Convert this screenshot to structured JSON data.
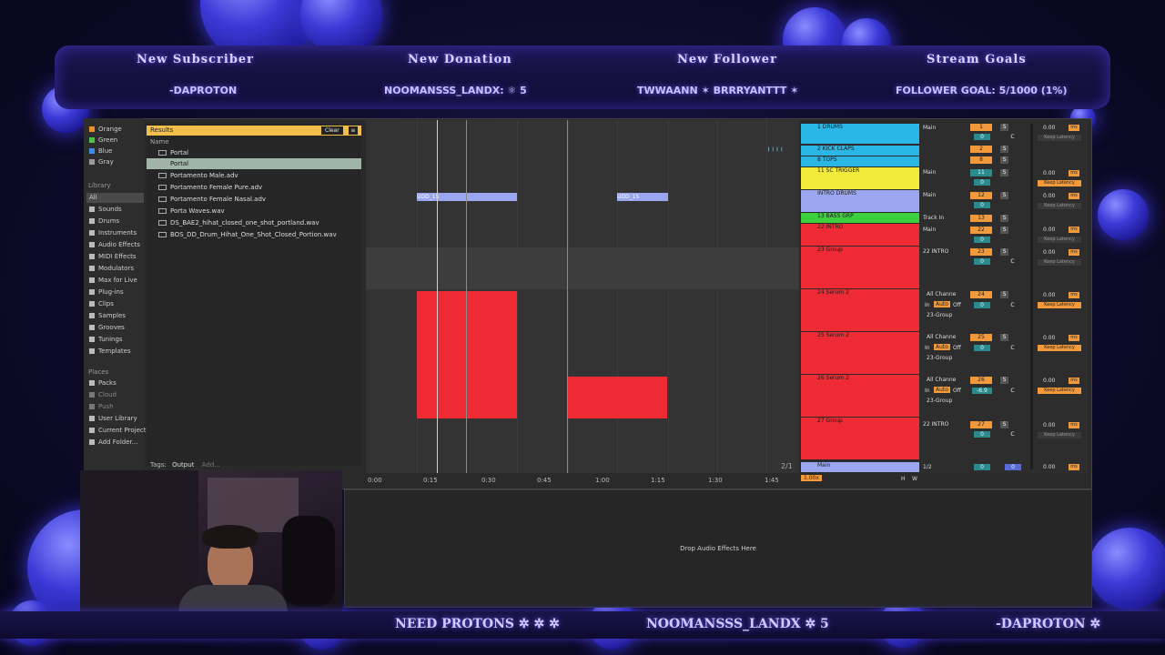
{
  "overlay": {
    "titles": [
      "New Subscriber",
      "New Donation",
      "New Follower",
      "Stream Goals"
    ],
    "subscriber": "-DAPROTON",
    "donation": "NOOMANSSS_LANDX: ⚛ 5",
    "followers": "TWWAANN  ✶  BRRRYANTTT  ✶",
    "goal": "FOLLOWER GOAL: 5/1000 (1%)",
    "bottom": [
      "NEED PROTONS ✲ ✲ ✲",
      "NOOMANSSS_LANDX ✲ 5",
      "-DAPROTON ✲"
    ]
  },
  "sidebar": {
    "colors": [
      {
        "label": "Orange",
        "color": "#f0902a"
      },
      {
        "label": "Green",
        "color": "#4cc24c"
      },
      {
        "label": "Blue",
        "color": "#3a8ee8"
      },
      {
        "label": "Gray",
        "color": "#9a9a9a"
      }
    ],
    "library_title": "Library",
    "library": [
      "All",
      "Sounds",
      "Drums",
      "Instruments",
      "Audio Effects",
      "MIDI Effects",
      "Modulators",
      "Max for Live",
      "Plug-ins",
      "Clips",
      "Samples",
      "Grooves",
      "Tunings",
      "Templates"
    ],
    "places_title": "Places",
    "places": [
      "Packs",
      "Cloud",
      "Push",
      "User Library",
      "Current Project",
      "Add Folder..."
    ]
  },
  "browser": {
    "results": "Results",
    "clear": "Clear",
    "name_header": "Name",
    "items": [
      "Portal",
      "Portal",
      "Portamento Male.adv",
      "Portamento Female Pure.adv",
      "Portamento Female Nasal.adv",
      "Porta Waves.wav",
      "DS_BAE2_hihat_closed_one_shot_portland.wav",
      "BOS_DD_Drum_Hihat_One_Shot_Closed_Portion.wav"
    ],
    "tags_label": "Tags:",
    "tags_output": "Output",
    "tags_add": "Add..."
  },
  "arrangement": {
    "clip_label": "UDD_15",
    "timeline": [
      "0:00",
      "0:15",
      "0:30",
      "0:45",
      "1:00",
      "1:15",
      "1:30",
      "1:45"
    ],
    "page": "2/1"
  },
  "tracks": [
    {
      "name": "1 DRUMS",
      "color": "#2ab7e6",
      "route": "Main",
      "num": "1"
    },
    {
      "name": "2 KICK CLAPS",
      "color": "#2ab7e6",
      "route": "",
      "num": "2"
    },
    {
      "name": "8 TOPS",
      "color": "#2ab7e6",
      "route": "",
      "num": "8"
    },
    {
      "name": "11 SC TRIGGER",
      "color": "#f2ea3a",
      "route": "Main",
      "num": "11"
    },
    {
      "name": "INTRO DRUMS",
      "color": "#9aa6f0",
      "route": "Main",
      "num": "12"
    },
    {
      "name": "13 BASS GRP",
      "color": "#3ecf3e",
      "route": "Track In",
      "num": "13"
    },
    {
      "name": "22 INTRO",
      "color": "#ee2a34",
      "route": "Main",
      "num": "22"
    },
    {
      "name": "23 Group",
      "color": "#ee2a34",
      "route": "22 INTRO",
      "num": "23"
    },
    {
      "name": "24 Serum 2",
      "color": "#ee2a34",
      "route": "All Channe",
      "num": "24"
    },
    {
      "name": "25 Serum 2",
      "color": "#ee2a34",
      "route": "All Channe",
      "num": "25"
    },
    {
      "name": "26 Serum 2",
      "color": "#ee2a34",
      "route": "All Channe",
      "num": "26"
    },
    {
      "name": "27 Group",
      "color": "#ee2a34",
      "route": "22 INTRO",
      "num": "27"
    }
  ],
  "mixer": {
    "main_label": "Main",
    "main_route": "1/2",
    "zoom": "1.00x",
    "db": "0.00",
    "ms": "ms",
    "keep_latency": "Keep Latency",
    "group_route": "23-Group",
    "in_label": "In",
    "auto_label": "Auto",
    "off_label": "Off",
    "s_label": "S",
    "c_label": "C",
    "zero": "0",
    "minus": "-6.9",
    "h_label": "H",
    "w_label": "W"
  },
  "device": {
    "drop_text": "Drop Audio Effects Here"
  }
}
